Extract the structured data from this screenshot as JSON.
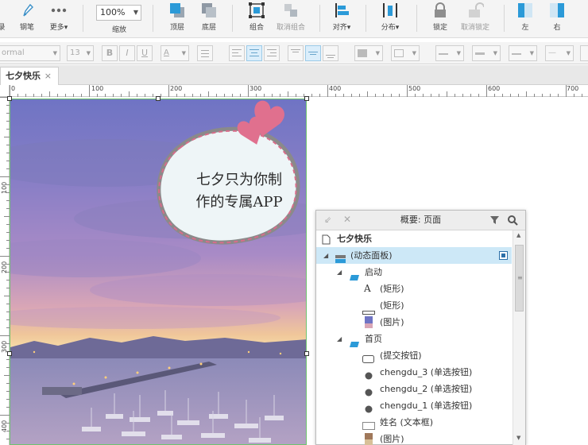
{
  "toolbar": {
    "items": [
      {
        "label": "录",
        "icon": "record-icon"
      },
      {
        "label": "钢笔",
        "icon": "pen-icon"
      },
      {
        "label": "更多▾",
        "icon": "more-icon"
      },
      {
        "label": "缩放",
        "icon": "zoom-select"
      },
      {
        "label": "顶层",
        "icon": "bring-to-front-icon"
      },
      {
        "label": "底层",
        "icon": "send-to-back-icon"
      },
      {
        "label": "组合",
        "icon": "group-icon"
      },
      {
        "label": "取消组合",
        "icon": "ungroup-icon"
      },
      {
        "label": "对齐▾",
        "icon": "align-icon"
      },
      {
        "label": "分布▾",
        "icon": "distribute-icon"
      },
      {
        "label": "锁定",
        "icon": "lock-icon"
      },
      {
        "label": "取消锁定",
        "icon": "unlock-icon"
      },
      {
        "label": "左",
        "icon": "panel-left-icon"
      },
      {
        "label": "右",
        "icon": "panel-right-icon"
      }
    ],
    "zoom_value": "100%"
  },
  "format_bar": {
    "font_style": "ormal",
    "font_size": "13",
    "bold": "B",
    "italic": "I",
    "underline": "U",
    "text_color": "A"
  },
  "tab": {
    "label": "七夕快乐",
    "close": "×"
  },
  "ruler": {
    "h_labels": [
      "0",
      "100",
      "200",
      "300",
      "400",
      "500",
      "600",
      "700"
    ],
    "v_labels": [
      "100",
      "200",
      "300",
      "400"
    ]
  },
  "canvas": {
    "bubble_line1": "七夕只为你制",
    "bubble_line2": "作的专属APP"
  },
  "outline_panel": {
    "title": "概要: 页面",
    "rows": [
      {
        "label": "七夕快乐",
        "icon": "page-icon",
        "level": 0,
        "bold": true
      },
      {
        "label": "(动态面板)",
        "icon": "dynamic-panel-icon",
        "level": 0,
        "selected": true
      },
      {
        "label": "启动",
        "icon": "state-icon",
        "level": 1
      },
      {
        "label": "(矩形)",
        "icon": "text-icon",
        "level": 2
      },
      {
        "label": "(矩形)",
        "icon": "rectangle-icon",
        "level": 2
      },
      {
        "label": "(图片)",
        "icon": "image-icon",
        "level": 2
      },
      {
        "label": "首页",
        "icon": "state-icon",
        "level": 1
      },
      {
        "label": "(提交按钮)",
        "icon": "button-icon",
        "level": 2
      },
      {
        "label": "chengdu_3 (单选按钮)",
        "icon": "radio-icon",
        "level": 2
      },
      {
        "label": "chengdu_2 (单选按钮)",
        "icon": "radio-icon",
        "level": 2
      },
      {
        "label": "chengdu_1 (单选按钮)",
        "icon": "radio-icon",
        "level": 2
      },
      {
        "label": "姓名 (文本框)",
        "icon": "textbox-icon",
        "level": 2
      },
      {
        "label": "(图片)",
        "icon": "image-icon",
        "level": 2
      }
    ]
  },
  "colors": {
    "accent_blue": "#2b9ad8",
    "selection": "#cde8f7",
    "heart_pink": "#e0708e",
    "bubble_fill": "#eef5f7"
  }
}
